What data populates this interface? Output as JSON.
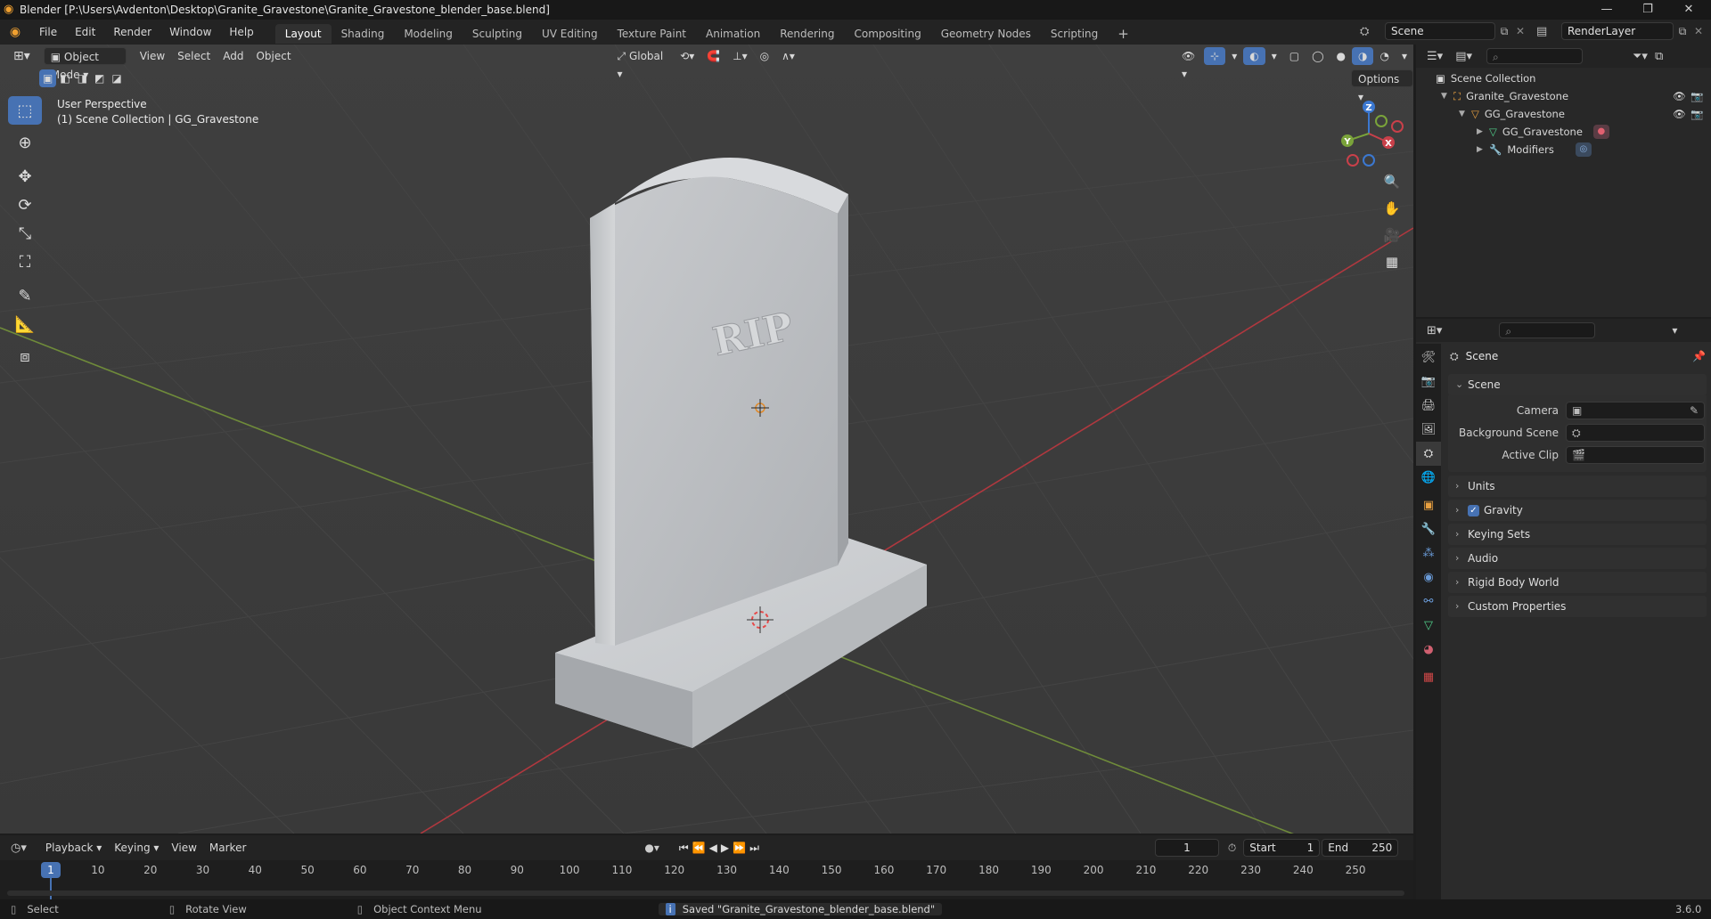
{
  "titlebar": {
    "title": "Blender [P:\\Users\\Avdenton\\Desktop\\Granite_Gravestone\\Granite_Gravestone_blender_base.blend]",
    "minimize": "—",
    "maximize": "❐",
    "close": "✕"
  },
  "menu": [
    "File",
    "Edit",
    "Render",
    "Window",
    "Help"
  ],
  "workspaces": [
    "Layout",
    "Shading",
    "Modeling",
    "Sculpting",
    "UV Editing",
    "Texture Paint",
    "Animation",
    "Rendering",
    "Compositing",
    "Geometry Nodes",
    "Scripting",
    "+"
  ],
  "scene_selector": {
    "value": "Scene"
  },
  "view_layer": {
    "value": "RenderLayer"
  },
  "viewport": {
    "mode": "Object Mode",
    "menus": [
      "View",
      "Select",
      "Add",
      "Object"
    ],
    "orientation": "Global",
    "options_label": "Options",
    "overlay_line1": "User Perspective",
    "overlay_line2": "(1) Scene Collection | GG_Gravestone",
    "engraving": "RIP",
    "axis_x": "X",
    "axis_y": "Y",
    "axis_z": "Z"
  },
  "outliner": {
    "root": "Scene Collection",
    "rows": [
      {
        "label": "Granite_Gravestone",
        "indent": 1,
        "icon": "collection-icon"
      },
      {
        "label": "GG_Gravestone",
        "indent": 2,
        "icon": "mesh-object-icon"
      },
      {
        "label": "GG_Gravestone",
        "indent": 3,
        "icon": "mesh-data-icon"
      },
      {
        "label": "Modifiers",
        "indent": 3,
        "icon": "wrench-icon"
      }
    ]
  },
  "properties": {
    "context_title": "Scene",
    "scene_panel": "Scene",
    "fields": [
      {
        "label": "Camera",
        "value": ""
      },
      {
        "label": "Background Scene",
        "value": ""
      },
      {
        "label": "Active Clip",
        "value": ""
      }
    ],
    "panels": [
      "Units",
      "Gravity",
      "Keying Sets",
      "Audio",
      "Rigid Body World",
      "Custom Properties"
    ]
  },
  "timeline": {
    "menus": [
      "Playback",
      "Keying",
      "View",
      "Marker"
    ],
    "current_frame": "1",
    "start_label": "Start",
    "start": "1",
    "end_label": "End",
    "end": "250",
    "ticks": [
      "10",
      "20",
      "30",
      "40",
      "50",
      "60",
      "70",
      "80",
      "90",
      "100",
      "110",
      "120",
      "130",
      "140",
      "150",
      "160",
      "170",
      "180",
      "190",
      "200",
      "210",
      "220",
      "230",
      "240",
      "250"
    ],
    "cursor_frame": "1"
  },
  "statusbar": {
    "select": "Select",
    "rotate": "Rotate View",
    "context_menu": "Object Context Menu",
    "message": "Saved \"Granite_Gravestone_blender_base.blend\"",
    "version": "3.6.0"
  },
  "colors": {
    "accent": "#4772b3",
    "x_axis": "#c9404a",
    "y_axis": "#7aa33a",
    "z_axis": "#3b78d1"
  }
}
